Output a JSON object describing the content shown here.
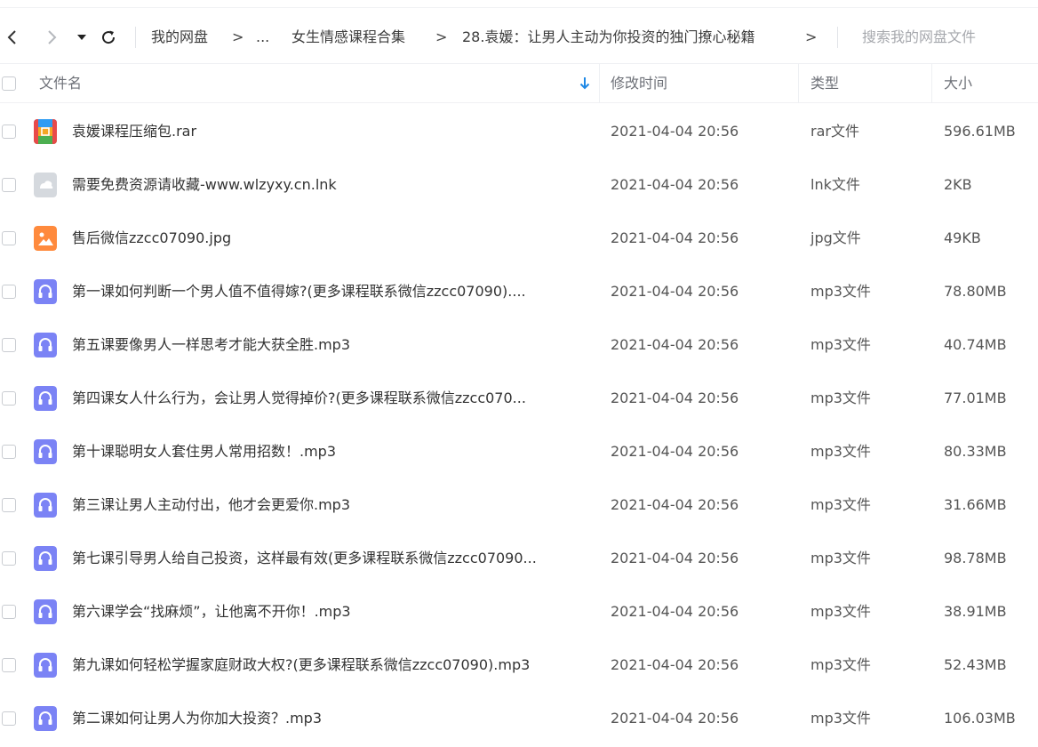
{
  "navbar": {
    "back_icon": "chevron-left-icon",
    "forward_icon": "chevron-right-icon",
    "history_icon": "caret-down-icon",
    "refresh_icon": "refresh-icon",
    "breadcrumbs": [
      "我的网盘",
      "...",
      "女生情感课程合集",
      "28.袁媛：让男人主动为你投资的独门撩心秘籍"
    ],
    "crumb_separator": ">",
    "search_placeholder": "搜索我的网盘文件"
  },
  "table": {
    "columns": {
      "name": "文件名",
      "modified": "修改时间",
      "type": "类型",
      "size": "大小"
    },
    "sort_icon": "arrow-down-icon",
    "rows": [
      {
        "name": "袁媛课程压缩包.rar",
        "modified": "2021-04-04 20:56",
        "type": "rar文件",
        "size": "596.61MB",
        "icon": "rar"
      },
      {
        "name": "需要免费资源请收藏-www.wlzyxy.cn.lnk",
        "modified": "2021-04-04 20:56",
        "type": "lnk文件",
        "size": "2KB",
        "icon": "lnk"
      },
      {
        "name": "售后微信zzcc07090.jpg",
        "modified": "2021-04-04 20:56",
        "type": "jpg文件",
        "size": "49KB",
        "icon": "jpg"
      },
      {
        "name": "第一课如何判断一个男人值不值得嫁?(更多课程联系微信zzcc07090)....",
        "modified": "2021-04-04 20:56",
        "type": "mp3文件",
        "size": "78.80MB",
        "icon": "mp3"
      },
      {
        "name": "第五课要像男人一样思考才能大获全胜.mp3",
        "modified": "2021-04-04 20:56",
        "type": "mp3文件",
        "size": "40.74MB",
        "icon": "mp3"
      },
      {
        "name": "第四课女人什么行为，会让男人觉得掉价?(更多课程联系微信zzcc070...",
        "modified": "2021-04-04 20:56",
        "type": "mp3文件",
        "size": "77.01MB",
        "icon": "mp3"
      },
      {
        "name": "第十课聪明女人套住男人常用招数！.mp3",
        "modified": "2021-04-04 20:56",
        "type": "mp3文件",
        "size": "80.33MB",
        "icon": "mp3"
      },
      {
        "name": "第三课让男人主动付出，他才会更爱你.mp3",
        "modified": "2021-04-04 20:56",
        "type": "mp3文件",
        "size": "31.66MB",
        "icon": "mp3"
      },
      {
        "name": "第七课引导男人给自己投资，这样最有效(更多课程联系微信zzcc07090...",
        "modified": "2021-04-04 20:56",
        "type": "mp3文件",
        "size": "98.78MB",
        "icon": "mp3"
      },
      {
        "name": "第六课学会“找麻烦”，让他离不开你！.mp3",
        "modified": "2021-04-04 20:56",
        "type": "mp3文件",
        "size": "38.91MB",
        "icon": "mp3"
      },
      {
        "name": "第九课如何轻松学握家庭财政大权?(更多课程联系微信zzcc07090).mp3",
        "modified": "2021-04-04 20:56",
        "type": "mp3文件",
        "size": "52.43MB",
        "icon": "mp3"
      },
      {
        "name": "第二课如何让男人为你加大投资？.mp3",
        "modified": "2021-04-04 20:56",
        "type": "mp3文件",
        "size": "106.03MB",
        "icon": "mp3"
      }
    ]
  },
  "colors": {
    "accent": "#1e88e5",
    "mp3": "#7b83f5",
    "jpg": "#ff8a3d",
    "lnk": "#d5d9de"
  }
}
